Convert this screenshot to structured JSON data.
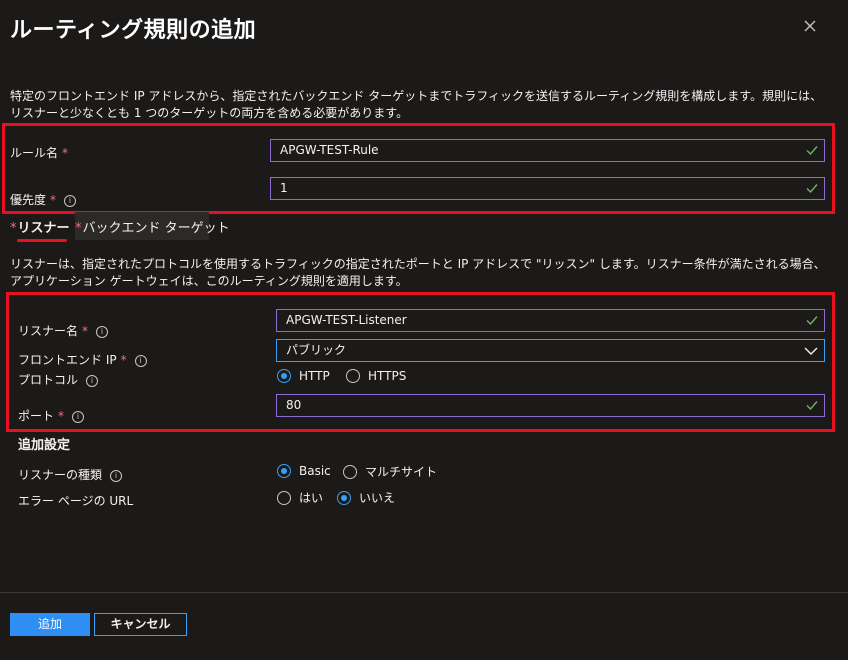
{
  "panel": {
    "title": "ルーティング規則の追加",
    "description": "特定のフロントエンド IP アドレスから、指定されたバックエンド ターゲットまでトラフィックを送信するルーティング規則を構成します。規則には、リスナーと少なくとも 1 つのターゲットの両方を含める必要があります。"
  },
  "rule": {
    "name_label": "ルール名",
    "name_value": "APGW-TEST-Rule",
    "priority_label": "優先度",
    "priority_value": "1",
    "required_mark": "*"
  },
  "tabs": [
    {
      "label": "リスナー",
      "required": "*",
      "active": true
    },
    {
      "label": "バックエンド ターゲット",
      "required": "*",
      "active": false
    }
  ],
  "listener": {
    "description": "リスナーは、指定されたプロトコルを使用するトラフィックの指定されたポートと IP アドレスで \"リッスン\" します。リスナー条件が満たされる場合、アプリケーション ゲートウェイは、このルーティング規則を適用します。",
    "name_label": "リスナー名",
    "name_value": "APGW-TEST-Listener",
    "frontend_ip_label": "フロントエンド IP",
    "frontend_ip_value": "パブリック",
    "protocol_label": "プロトコル",
    "protocol_options": [
      "HTTP",
      "HTTPS"
    ],
    "protocol_selected": "HTTP",
    "port_label": "ポート",
    "port_value": "80"
  },
  "additional": {
    "heading": "追加設定",
    "listener_type_label": "リスナーの種類",
    "listener_type_options": [
      "Basic",
      "マルチサイト"
    ],
    "listener_type_selected": "Basic",
    "error_page_label": "エラー ページの URL",
    "error_page_options": [
      "はい",
      "いいえ"
    ],
    "error_page_selected": "いいえ"
  },
  "footer": {
    "add_label": "追加",
    "cancel_label": "キャンセル"
  },
  "icons": {
    "close": "close-icon",
    "info": "info-icon",
    "check": "checkmark-icon",
    "chevron": "chevron-down-icon"
  },
  "colors": {
    "background": "#1b1a19",
    "accent": "#3aa0f3",
    "primary_button": "#2f8ef3",
    "input_border": "#8f6ad3",
    "valid_check": "#74b06b",
    "required": "#f1707b",
    "highlight_box": "#e81123"
  }
}
